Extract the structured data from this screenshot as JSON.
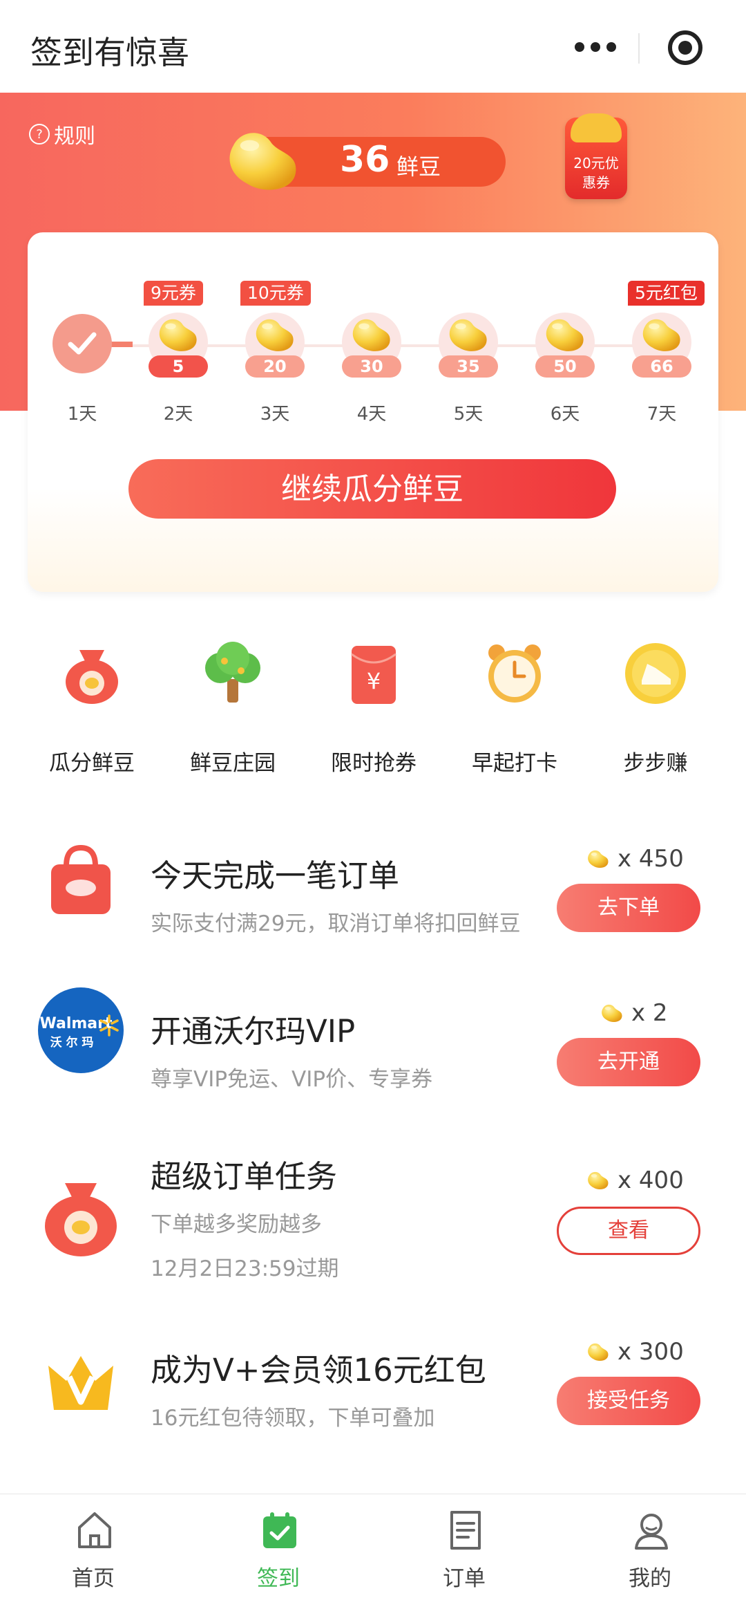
{
  "nav": {
    "title": "签到有惊喜",
    "more_icon": "more-dots-icon",
    "close_icon": "record-icon"
  },
  "header": {
    "rules": "规则",
    "beans_count": "36",
    "beans_unit": "鲜豆",
    "coupon_line1": "20元优",
    "coupon_line2": "惠券"
  },
  "checkin": {
    "days": [
      {
        "label": "1天",
        "value": "",
        "done": true
      },
      {
        "label": "2天",
        "value": "5",
        "tag": "9元券"
      },
      {
        "label": "3天",
        "value": "20",
        "tag": "10元券"
      },
      {
        "label": "4天",
        "value": "30"
      },
      {
        "label": "5天",
        "value": "35"
      },
      {
        "label": "6天",
        "value": "50"
      },
      {
        "label": "7天",
        "value": "66",
        "tag": "5元红包"
      }
    ],
    "button": "继续瓜分鲜豆"
  },
  "entries": [
    {
      "label": "瓜分鲜豆",
      "icon": "money-bag-icon"
    },
    {
      "label": "鲜豆庄园",
      "icon": "tree-icon"
    },
    {
      "label": "限时抢券",
      "icon": "red-envelope-icon"
    },
    {
      "label": "早起打卡",
      "icon": "alarm-clock-icon"
    },
    {
      "label": "步步赚",
      "icon": "shoe-coin-icon"
    }
  ],
  "tasks": [
    {
      "title": "今天完成一笔订单",
      "sub": "实际支付满29元，取消订单将扣回鲜豆",
      "sub2": "",
      "reward": "x 450",
      "button": "去下单",
      "icon": "shopping-bag-icon"
    },
    {
      "title": "开通沃尔玛VIP",
      "sub": "尊享VIP免运、VIP价、专享券",
      "sub2": "",
      "reward": "x 2",
      "button": "去开通",
      "icon": "walmart-logo",
      "logo_line1": "Walmart",
      "logo_line2": "沃 尔 玛"
    },
    {
      "title": "超级订单任务",
      "sub": "下单越多奖励越多",
      "sub2": "12月2日23:59过期",
      "reward": "x 400",
      "button": "查看",
      "icon": "money-bag-icon"
    },
    {
      "title": "成为V+会员领16元红包",
      "sub": "16元红包待领取，下单可叠加",
      "sub2": "",
      "reward": "x 300",
      "button": "接受任务",
      "icon": "crown-v-icon"
    }
  ],
  "tabbar": [
    {
      "label": "首页",
      "icon": "home-icon"
    },
    {
      "label": "签到",
      "icon": "calendar-check-icon",
      "active": true
    },
    {
      "label": "订单",
      "icon": "order-list-icon"
    },
    {
      "label": "我的",
      "icon": "user-icon"
    }
  ],
  "colors": {
    "accent": "#f2534b",
    "active_tab": "#3fb855",
    "bean": "#f7c33a"
  }
}
